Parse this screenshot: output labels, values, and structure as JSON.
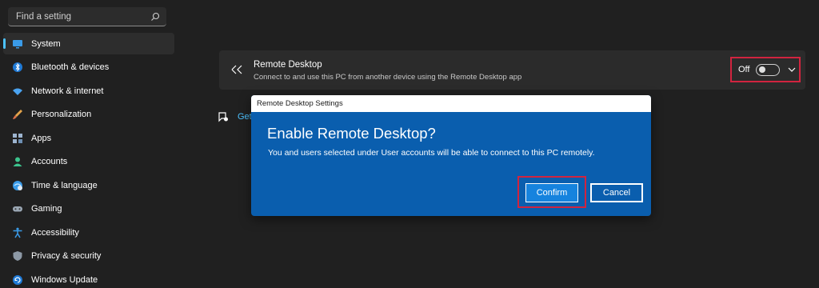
{
  "search": {
    "placeholder": "Find a setting"
  },
  "sidebar": {
    "items": [
      {
        "label": "System",
        "icon": "system-icon",
        "active": true
      },
      {
        "label": "Bluetooth & devices",
        "icon": "bluetooth-icon"
      },
      {
        "label": "Network & internet",
        "icon": "wifi-icon"
      },
      {
        "label": "Personalization",
        "icon": "brush-icon"
      },
      {
        "label": "Apps",
        "icon": "apps-icon"
      },
      {
        "label": "Accounts",
        "icon": "person-icon"
      },
      {
        "label": "Time & language",
        "icon": "globe-clock-icon"
      },
      {
        "label": "Gaming",
        "icon": "gamepad-icon"
      },
      {
        "label": "Accessibility",
        "icon": "accessibility-icon"
      },
      {
        "label": "Privacy & security",
        "icon": "shield-icon"
      },
      {
        "label": "Windows Update",
        "icon": "update-icon"
      }
    ]
  },
  "main": {
    "remote_desktop": {
      "title": "Remote Desktop",
      "subtitle": "Connect to and use this PC from another device using the Remote Desktop app",
      "toggle_state": "Off",
      "toggle_on": false
    },
    "get_help": "Get"
  },
  "dialog": {
    "window_title": "Remote Desktop Settings",
    "heading": "Enable Remote Desktop?",
    "message": "You and users selected under User accounts will be able to connect to this PC remotely.",
    "confirm_label": "Confirm",
    "cancel_label": "Cancel"
  },
  "colors": {
    "accent": "#4cc2ff",
    "dialog_bg": "#0a5eae",
    "highlight": "#d1243f"
  }
}
